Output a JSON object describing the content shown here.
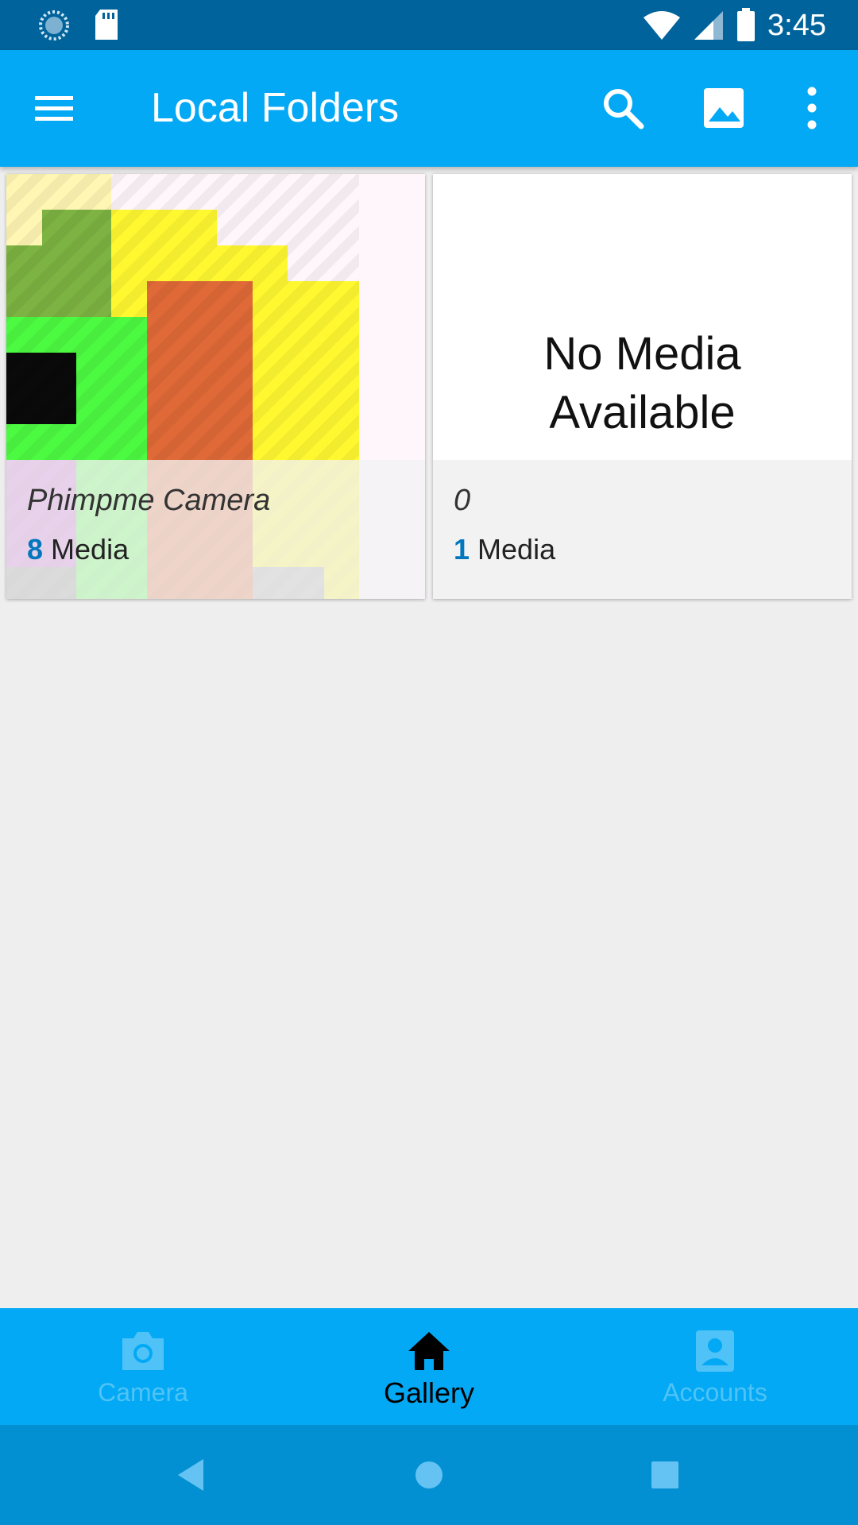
{
  "status_bar": {
    "time": "3:45",
    "icons": [
      "sync-icon",
      "sd-card-icon",
      "wifi-icon",
      "signal-icon",
      "battery-icon"
    ]
  },
  "app_bar": {
    "title": "Local Folders",
    "actions": [
      "search-icon",
      "image-icon",
      "more-vert-icon"
    ],
    "color": "#03a9f4"
  },
  "folders": [
    {
      "name": "Phimpme Camera",
      "count": "8",
      "count_label": "Media"
    },
    {
      "name": "0",
      "count": "1",
      "count_label": "Media",
      "placeholder_text_line1": "No Media",
      "placeholder_text_line2": "Available"
    }
  ],
  "bottom_nav": {
    "items": [
      {
        "label": "Camera",
        "icon": "camera-icon",
        "active": false
      },
      {
        "label": "Gallery",
        "icon": "home-icon",
        "active": true
      },
      {
        "label": "Accounts",
        "icon": "account-box-icon",
        "active": false
      }
    ]
  },
  "system_nav": [
    "back-icon",
    "home-circle-icon",
    "recents-icon"
  ],
  "colors": {
    "accent": "#03a9f4",
    "status_bar": "#01639b",
    "count_accent": "#0277bd"
  }
}
